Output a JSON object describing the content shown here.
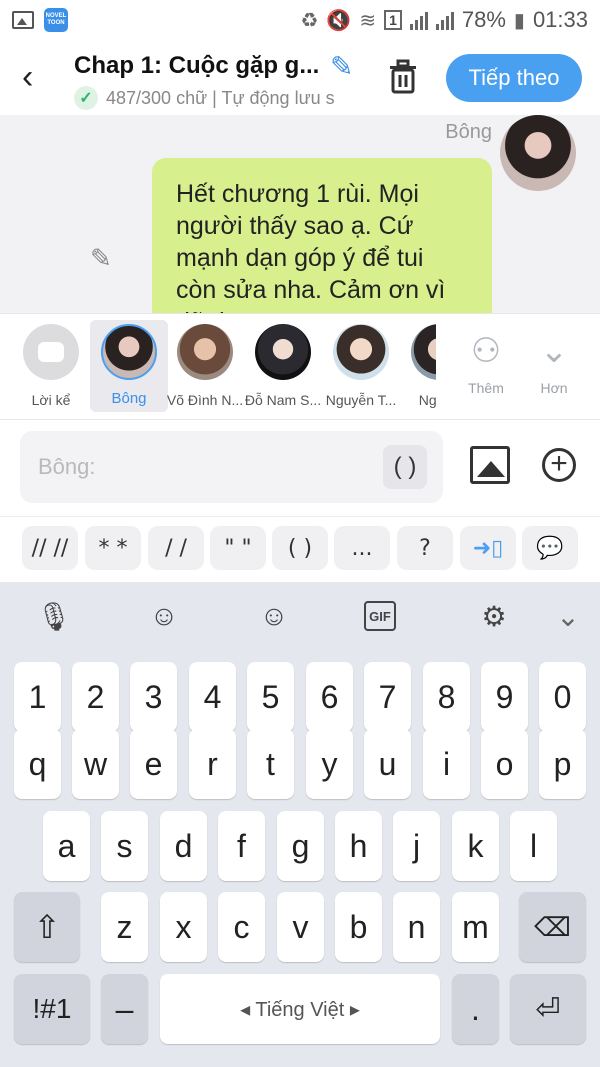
{
  "statusbar": {
    "battery": "78%",
    "time": "01:33",
    "sim_badge": "1",
    "app_badge_line1": "NOVEL",
    "app_badge_line2": "TOON"
  },
  "header": {
    "title": "Chap 1: Cuộc gặp g...",
    "word_count": "487/300 chữ | Tự động lưu s",
    "next_label": "Tiếp theo"
  },
  "chat": {
    "sender": "Bông",
    "message": "Hết chương 1 rùi. Mọi người thấy sao ạ. Cứ mạnh dạn góp ý để tui còn sửa nha. Cảm ơn vì đã đọc"
  },
  "characters": [
    {
      "name": "Lời kể"
    },
    {
      "name": "Bông"
    },
    {
      "name": "Võ Đình N..."
    },
    {
      "name": "Đỗ Nam S..."
    },
    {
      "name": "Nguyễn T..."
    },
    {
      "name": "Nguyễ"
    }
  ],
  "char_actions": {
    "add_label": "Thêm",
    "more_label": "Hơn"
  },
  "composer": {
    "placeholder": "Bông:",
    "paren_label": "( )"
  },
  "symbols": [
    "// //",
    "* *",
    "/ /",
    "\" \"",
    "( )",
    "...",
    "?"
  ],
  "keyboard": {
    "numbers": [
      "1",
      "2",
      "3",
      "4",
      "5",
      "6",
      "7",
      "8",
      "9",
      "0"
    ],
    "row1": [
      "q",
      "w",
      "e",
      "r",
      "t",
      "y",
      "u",
      "i",
      "o",
      "p"
    ],
    "row2": [
      "a",
      "s",
      "d",
      "f",
      "g",
      "h",
      "j",
      "k",
      "l"
    ],
    "row3": [
      "z",
      "x",
      "c",
      "v",
      "b",
      "n",
      "m"
    ],
    "symbols_key": "!#1",
    "dash_key": "–",
    "space_label": "◂  Tiếng Việt  ▸",
    "period_key": ".",
    "gif_label": "GIF"
  },
  "colors": {
    "accent": "#4aa0f0",
    "bubble": "#d7f08d",
    "keyboard_bg": "#e5e7ee"
  }
}
